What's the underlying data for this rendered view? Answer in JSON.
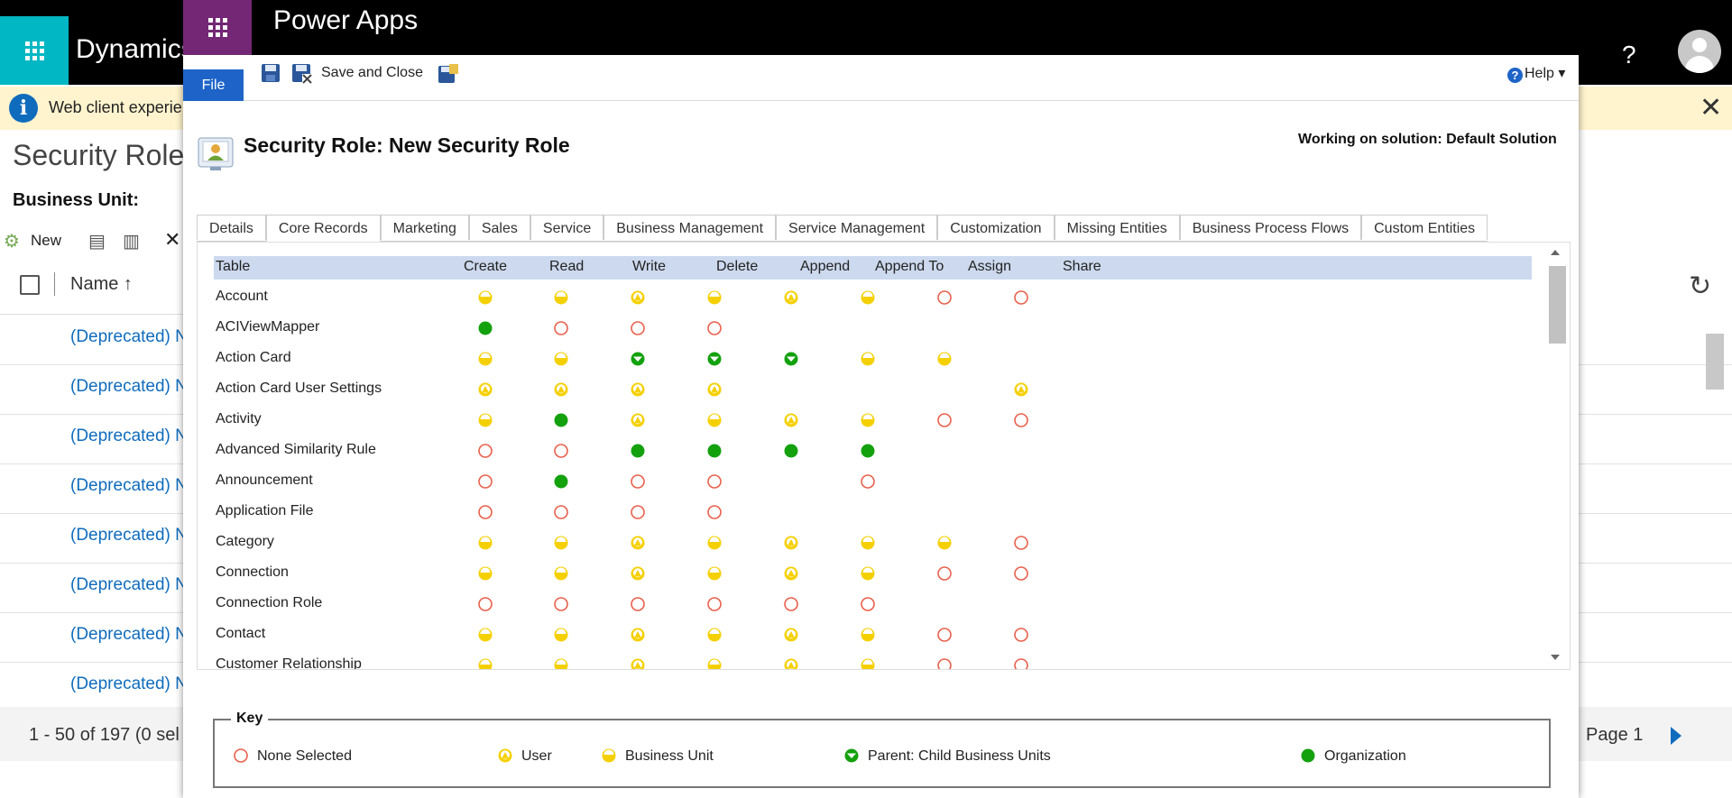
{
  "background_app": {
    "title": "Dynamics",
    "notice_text": "Web client experien",
    "page_title": "Security Roles",
    "business_unit_label": "Business Unit:",
    "new_label": "New",
    "name_column": "Name ↑",
    "row_label": "(Deprecated) N",
    "row_count": 8,
    "footer_text": "1 - 50 of 197 (0 sel",
    "page_label": "Page 1"
  },
  "dialog": {
    "app_title": "Power Apps",
    "ribbon": {
      "file_label": "File",
      "save_close_label": "Save and Close",
      "help_label": "Help"
    },
    "role_title": "Security Role: New Security Role",
    "solution_text": "Working on solution: Default Solution",
    "tabs": [
      "Details",
      "Core Records",
      "Marketing",
      "Sales",
      "Service",
      "Business Management",
      "Service Management",
      "Customization",
      "Missing Entities",
      "Business Process Flows",
      "Custom Entities"
    ],
    "active_tab": "Core Records",
    "columns": [
      "Table",
      "Create",
      "Read",
      "Write",
      "Delete",
      "Append",
      "Append To",
      "Assign",
      "Share"
    ],
    "rows": [
      {
        "name": "Account",
        "levels": [
          "bu",
          "bu",
          "user",
          "bu",
          "user",
          "bu",
          "none",
          "none"
        ]
      },
      {
        "name": "ACIViewMapper",
        "levels": [
          "org",
          "none",
          "none",
          "none",
          "",
          "",
          "",
          ""
        ]
      },
      {
        "name": "Action Card",
        "levels": [
          "bu",
          "bu",
          "parent",
          "parent",
          "parent",
          "bu",
          "bu",
          ""
        ]
      },
      {
        "name": "Action Card User Settings",
        "levels": [
          "user",
          "user",
          "user",
          "user",
          "",
          "",
          "",
          "user"
        ]
      },
      {
        "name": "Activity",
        "levels": [
          "bu",
          "org",
          "user",
          "bu",
          "user",
          "bu",
          "none",
          "none"
        ]
      },
      {
        "name": "Advanced Similarity Rule",
        "levels": [
          "none",
          "none",
          "org",
          "org",
          "org",
          "org",
          "",
          ""
        ]
      },
      {
        "name": "Announcement",
        "levels": [
          "none",
          "org",
          "none",
          "none",
          "",
          "none",
          "",
          ""
        ]
      },
      {
        "name": "Application File",
        "levels": [
          "none",
          "none",
          "none",
          "none",
          "",
          "",
          "",
          ""
        ]
      },
      {
        "name": "Category",
        "levels": [
          "bu",
          "bu",
          "user",
          "bu",
          "user",
          "bu",
          "bu",
          "none"
        ]
      },
      {
        "name": "Connection",
        "levels": [
          "bu",
          "bu",
          "user",
          "bu",
          "user",
          "bu",
          "none",
          "none"
        ]
      },
      {
        "name": "Connection Role",
        "levels": [
          "none",
          "none",
          "none",
          "none",
          "none",
          "none",
          "",
          ""
        ]
      },
      {
        "name": "Contact",
        "levels": [
          "bu",
          "bu",
          "user",
          "bu",
          "user",
          "bu",
          "none",
          "none"
        ]
      },
      {
        "name": "Customer Relationship",
        "levels": [
          "bu",
          "bu",
          "user",
          "bu",
          "user",
          "bu",
          "none",
          "none"
        ]
      }
    ],
    "key": {
      "title": "Key",
      "items": [
        {
          "level": "none",
          "label": "None Selected"
        },
        {
          "level": "user",
          "label": "User"
        },
        {
          "level": "bu",
          "label": "Business Unit"
        },
        {
          "level": "parent",
          "label": "Parent: Child Business Units"
        },
        {
          "level": "org",
          "label": "Organization"
        }
      ]
    }
  },
  "colors": {
    "dialog_waffle": "#742774",
    "background_waffle": "#00b7c3",
    "file_tab": "#1e64c8",
    "grid_header": "#ccd9ee",
    "notice_bg": "#fff4ce",
    "link": "#0f6cbd",
    "privilege_none": "#e8604c",
    "privilege_yellow": "#f5d000",
    "privilege_green": "#13a10e"
  }
}
